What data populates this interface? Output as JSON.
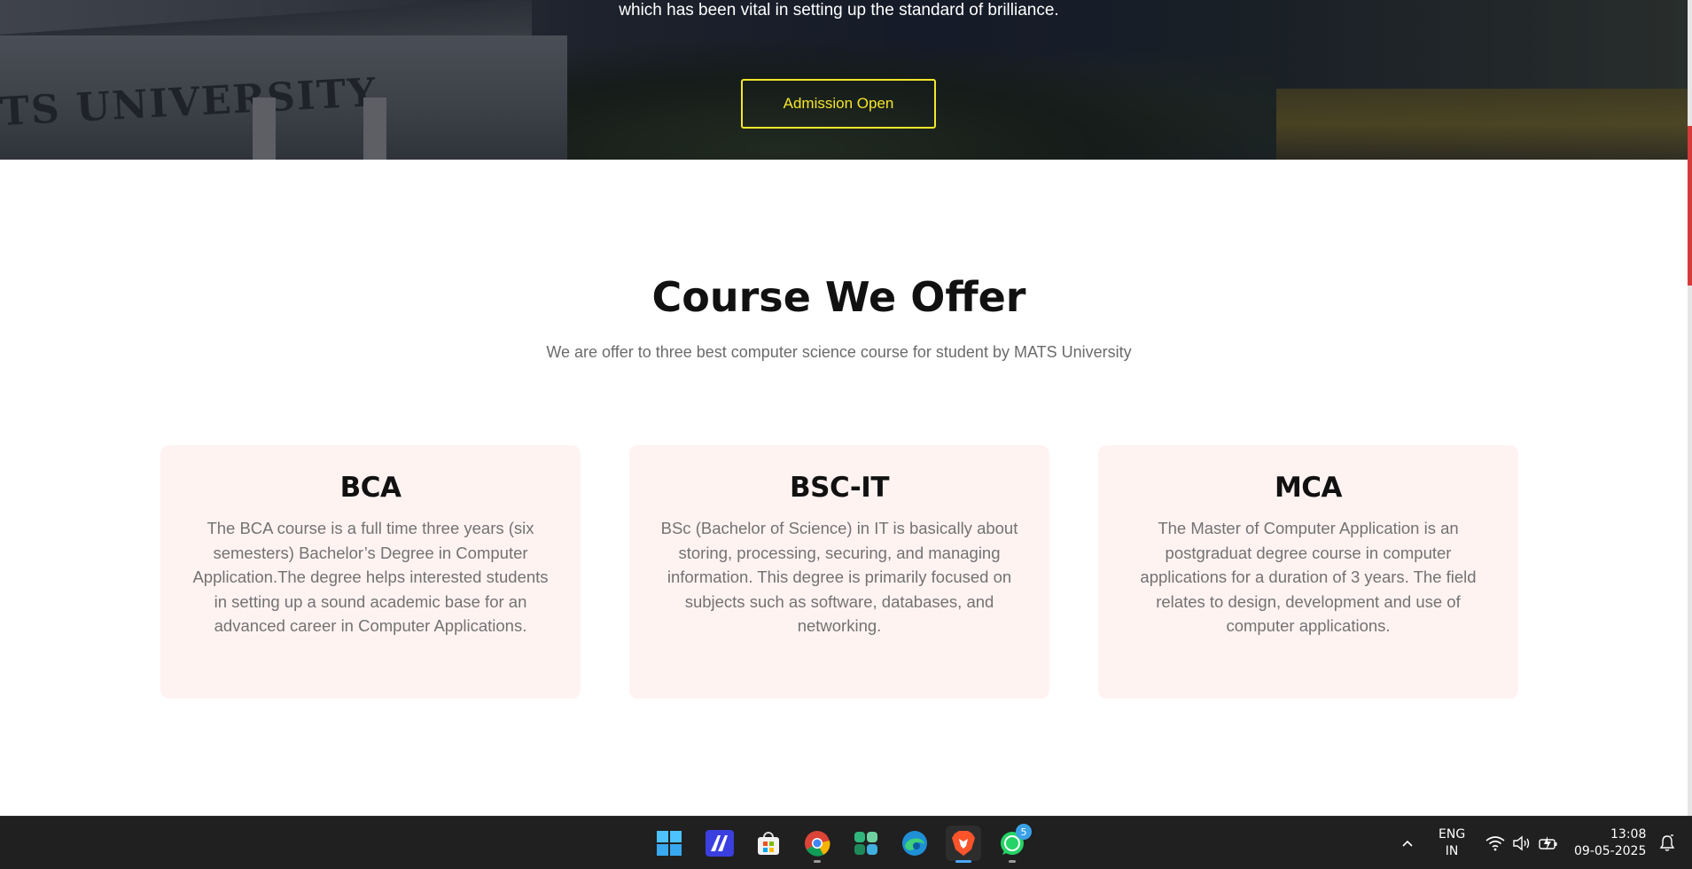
{
  "hero": {
    "tagline": "which has been vital in setting up the standard of brilliance.",
    "admission_button": "Admission Open",
    "sign_text": "TS UNIVERSITY"
  },
  "courses": {
    "title": "Course We Offer",
    "subtitle": "We are offer to three best computer science course for student by MATS University",
    "items": [
      {
        "name": "BCA",
        "description": "The BCA course is a full time three years (six semesters) Bachelor’s Degree in Computer Application.The degree helps interested students in setting up a sound academic base for an advanced career in Computer Applications."
      },
      {
        "name": "BSC-IT",
        "description": "BSc (Bachelor of Science) in IT is basically about storing, processing, securing, and managing information. This degree is primarily focused on subjects such as software, databases, and networking."
      },
      {
        "name": "MCA",
        "description": "The Master of Computer Application is an postgraduat degree course in computer applications for a duration of 3 years. The field relates to design, development and use of computer applications."
      }
    ]
  },
  "colors": {
    "accent_button": "#f5e62a",
    "card_background": "#fff3f2",
    "scroll_thumb": "#d43b3b",
    "taskbar": "#202020"
  },
  "taskbar": {
    "apps": [
      {
        "name": "start",
        "icon": "windows-logo-icon"
      },
      {
        "name": "ai-app",
        "icon": "ai-slash-icon"
      },
      {
        "name": "store",
        "icon": "store-bag-icon"
      },
      {
        "name": "chrome",
        "icon": "chrome-icon"
      },
      {
        "name": "app-green",
        "icon": "clover-app-icon"
      },
      {
        "name": "edge",
        "icon": "edge-icon"
      },
      {
        "name": "brave",
        "icon": "brave-lion-icon",
        "active": true
      },
      {
        "name": "whatsapp",
        "icon": "whatsapp-icon",
        "badge": "5"
      }
    ],
    "language_line1": "ENG",
    "language_line2": "IN",
    "time": "13:08",
    "date": "09-05-2025"
  }
}
